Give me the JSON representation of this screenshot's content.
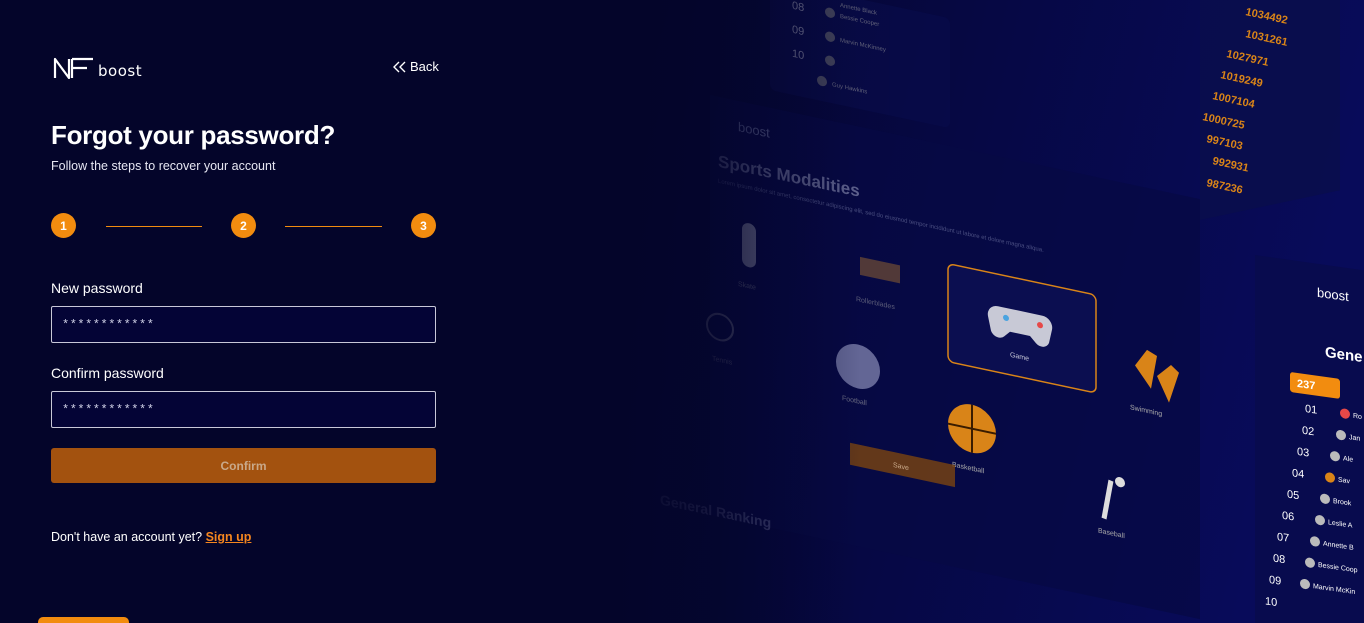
{
  "brand": {
    "logo_text": "boost"
  },
  "header": {
    "back_label": "Back"
  },
  "page": {
    "title": "Forgot your password?",
    "subtitle": "Follow the steps to recover your account"
  },
  "stepper": {
    "steps": [
      "1",
      "2",
      "3"
    ],
    "current_step": 1
  },
  "form": {
    "new_password": {
      "label": "New password",
      "value": "************"
    },
    "confirm_password": {
      "label": "Confirm password",
      "value": "************"
    },
    "confirm_button": "Confirm"
  },
  "footer": {
    "prompt": "Don't have an account yet?",
    "signup_link": "Sign up"
  },
  "background": {
    "ranking_numbers": [
      "08",
      "09",
      "10"
    ],
    "ranking_names": [
      "Annette Black",
      "Bessie Cooper",
      "Marvin McKinney",
      "Guy Hawkins"
    ],
    "scores": [
      "1034492",
      "1031261",
      "1027971",
      "1019249",
      "1007104",
      "1000725",
      "997103",
      "992931",
      "987236"
    ],
    "logo_text": "boost",
    "modalities_title": "Sports Modalities",
    "modalities_description": "Lorem ipsum dolor sit amet, consectetur adipiscing elit, sed do eiusmod tempor incididunt ut labore et dolore magna aliqua.",
    "sports": [
      "Skate",
      "Rollerblades",
      "Game",
      "Swimming",
      "Tennis",
      "Football",
      "Basketball",
      "Baseball"
    ],
    "save_label": "Save",
    "general_ranking_title": "General Ranking",
    "panel_title": "Gene",
    "panel_badge": "237",
    "panel_ranks": [
      "01",
      "02",
      "03",
      "04",
      "05",
      "06",
      "07",
      "08",
      "09",
      "10"
    ],
    "panel_names": [
      "Ro",
      "Jan",
      "Ale",
      "Sav",
      "Brook",
      "Leslie A",
      "Annette B",
      "Bessie Coop",
      "Marvin McKin"
    ],
    "accent_color": "#f28c0f",
    "background_color": "#04052a"
  }
}
